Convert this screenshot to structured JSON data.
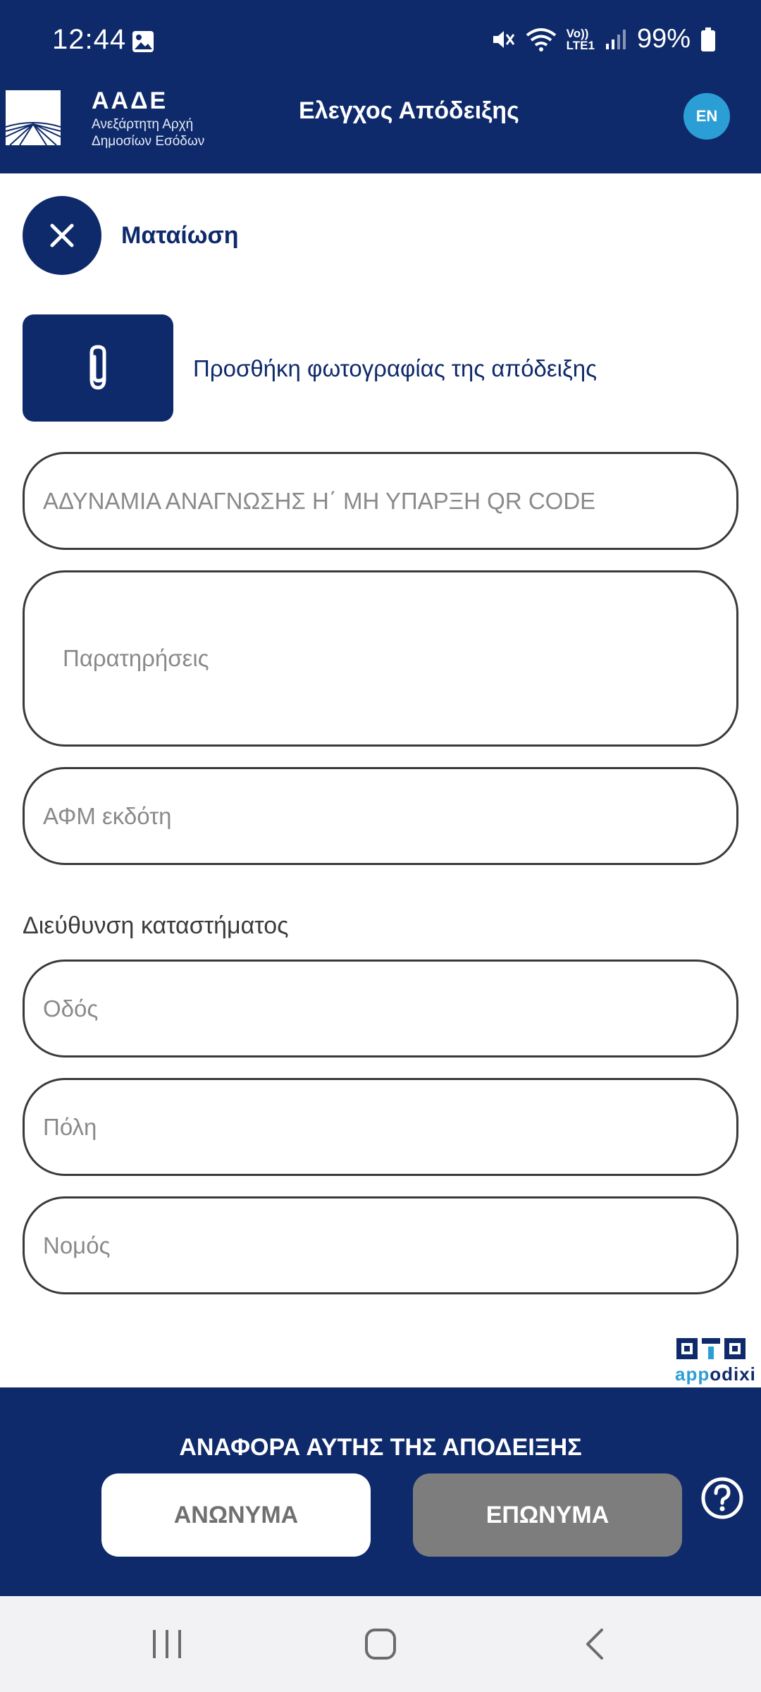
{
  "status_bar": {
    "time": "12:44",
    "battery": "99%",
    "network_label_top": "Vo))",
    "network_label_bottom": "LTE1",
    "icons": [
      "image-icon",
      "mute-icon",
      "wifi-icon",
      "volte-icon",
      "signal-icon",
      "battery-icon"
    ]
  },
  "header": {
    "logo_abbr": "ΑΑΔΕ",
    "logo_line1": "Ανεξάρτητη Αρχή",
    "logo_line2": "Δημοσίων Εσόδων",
    "title": "Ελεγχος Απόδειξης",
    "lang_button": "EN"
  },
  "form": {
    "cancel_label": "Ματαίωση",
    "attach_label": "Προσθήκη φωτογραφίας της απόδειξης",
    "qr_placeholder": "ΑΔΥΝΑΜΙΑ ΑΝΑΓΝΩΣΗΣ Η΄ ΜΗ ΥΠΑΡΞΗ QR CODE",
    "notes_placeholder": "Παρατηρήσεις",
    "afm_placeholder": "ΑΦΜ εκδότη",
    "address_label": "Διεύθυνση καταστήματος",
    "street_placeholder": "Οδός",
    "city_placeholder": "Πόλη",
    "prefecture_placeholder": "Νομός"
  },
  "brand": {
    "part1": "app",
    "part2": "odixi"
  },
  "report": {
    "title": "ΑΝΑΦΟΡΑ ΑΥΤΗΣ ΤΗΣ ΑΠΟΔΕΙΞΗΣ",
    "anonymous_label": "ΑΝΩΝΥΜΑ",
    "named_label": "ΕΠΩΝΥΜΑ"
  },
  "colors": {
    "primary": "#0f2a6b",
    "accent": "#2c9ed6",
    "disabled_button": "#7d7d7d"
  }
}
